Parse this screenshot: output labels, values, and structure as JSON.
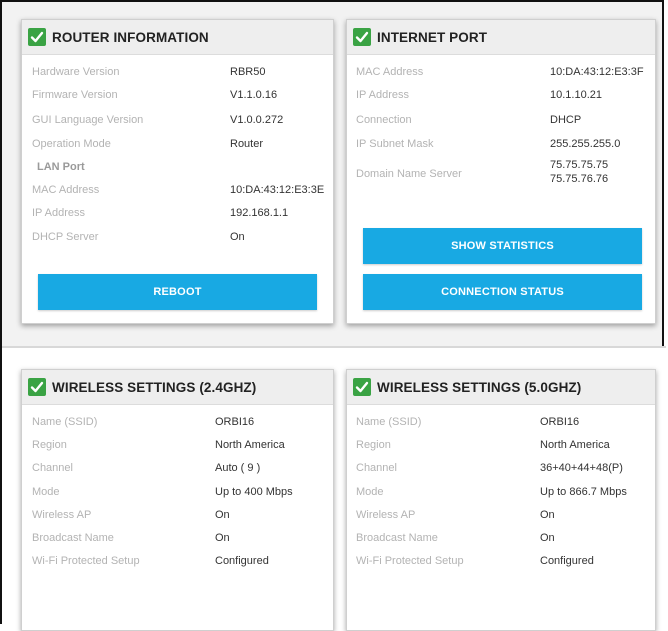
{
  "router": {
    "title": "ROUTER INFORMATION",
    "rows": [
      {
        "label": "Hardware Version",
        "value": "RBR50"
      },
      {
        "label": "Firmware Version",
        "value": "V1.1.0.16"
      },
      {
        "label": "GUI Language Version",
        "value": "V1.0.0.272"
      },
      {
        "label": "Operation Mode",
        "value": "Router"
      }
    ],
    "lan_heading": "LAN Port",
    "lan_rows": [
      {
        "label": "MAC Address",
        "value": "10:DA:43:12:E3:3E"
      },
      {
        "label": "IP Address",
        "value": "192.168.1.1"
      },
      {
        "label": "DHCP Server",
        "value": "On"
      }
    ],
    "reboot_label": "REBOOT"
  },
  "internet": {
    "title": "INTERNET PORT",
    "rows": [
      {
        "label": "MAC Address",
        "value": "10:DA:43:12:E3:3F"
      },
      {
        "label": "IP Address",
        "value": "10.1.10.21"
      },
      {
        "label": "Connection",
        "value": "DHCP"
      },
      {
        "label": "IP Subnet Mask",
        "value": "255.255.255.0"
      }
    ],
    "dns_label": "Domain Name Server",
    "dns_values": [
      "75.75.75.75",
      "75.75.76.76"
    ],
    "show_stats_label": "SHOW STATISTICS",
    "conn_status_label": "CONNECTION STATUS"
  },
  "wireless24": {
    "title": "WIRELESS SETTINGS (2.4GHZ)",
    "rows": [
      {
        "label": "Name (SSID)",
        "value": "ORBI16"
      },
      {
        "label": "Region",
        "value": "North America"
      },
      {
        "label": "Channel",
        "value": "Auto ( 9 )"
      },
      {
        "label": "Mode",
        "value": "Up to 400 Mbps"
      },
      {
        "label": "Wireless AP",
        "value": "On"
      },
      {
        "label": "Broadcast Name",
        "value": "On"
      },
      {
        "label": "Wi-Fi Protected Setup",
        "value": "Configured"
      }
    ]
  },
  "wireless5": {
    "title": "WIRELESS SETTINGS (5.0GHZ)",
    "rows": [
      {
        "label": "Name (SSID)",
        "value": "ORBI16"
      },
      {
        "label": "Region",
        "value": "North America"
      },
      {
        "label": "Channel",
        "value": "36+40+44+48(P)"
      },
      {
        "label": "Mode",
        "value": "Up to 866.7 Mbps"
      },
      {
        "label": "Wireless AP",
        "value": "On"
      },
      {
        "label": "Broadcast Name",
        "value": "On"
      },
      {
        "label": "Wi-Fi Protected Setup",
        "value": "Configured"
      }
    ]
  },
  "colors": {
    "accent": "#18a9e3",
    "check": "#3aa344"
  },
  "icons": {
    "header": "checkmark-icon"
  }
}
